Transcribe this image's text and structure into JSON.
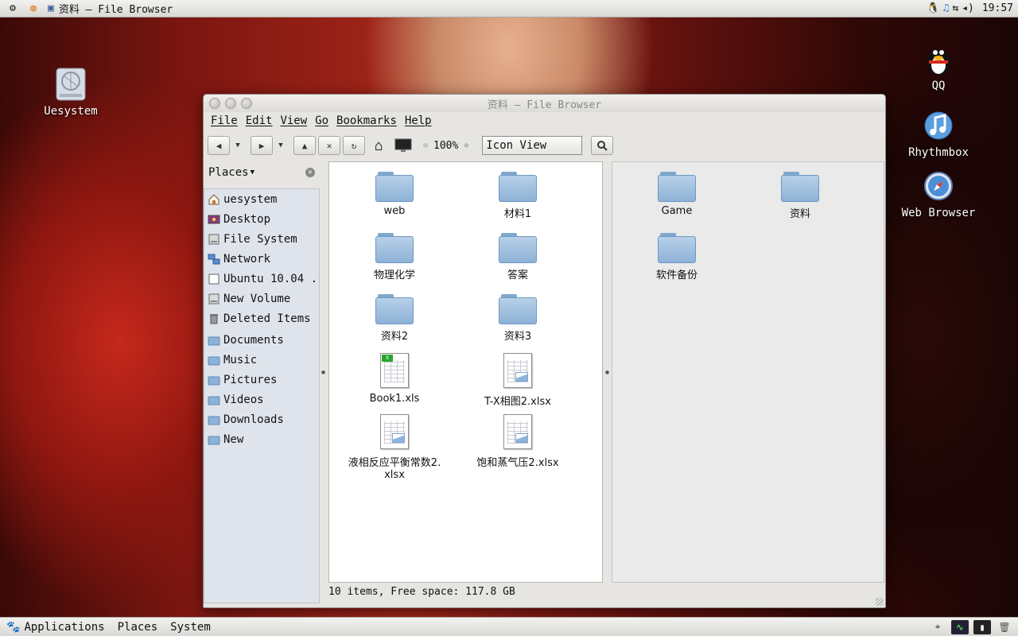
{
  "top_panel": {
    "window_title": "资料 — File Browser",
    "clock": "19:57"
  },
  "bottom_panel": {
    "menus": [
      "Applications",
      "Places",
      "System"
    ]
  },
  "desktop_icons": {
    "uesystem": "Uesystem",
    "qq": "QQ",
    "rhythmbox": "Rhythmbox",
    "web_browser": "Web Browser"
  },
  "window": {
    "title": "资料 — File Browser",
    "menu": [
      "File",
      "Edit",
      "View",
      "Go",
      "Bookmarks",
      "Help"
    ],
    "zoom": "100%",
    "view_mode": "Icon View",
    "sidebar": {
      "header": "Places",
      "items": [
        {
          "label": "uesystem",
          "icon": "home-icon"
        },
        {
          "label": "Desktop",
          "icon": "desktop-icon"
        },
        {
          "label": "File System",
          "icon": "drive-icon"
        },
        {
          "label": "Network",
          "icon": "network-icon"
        },
        {
          "label": "Ubuntu 10.04 ...",
          "icon": "disc-icon"
        },
        {
          "label": "New Volume",
          "icon": "drive-icon"
        },
        {
          "label": "Deleted Items",
          "icon": "trash-icon"
        }
      ],
      "bookmarks": [
        "Documents",
        "Music",
        "Pictures",
        "Videos",
        "Downloads",
        "New"
      ]
    },
    "left_pane": [
      {
        "name": "web",
        "type": "folder"
      },
      {
        "name": "材料1",
        "type": "folder"
      },
      {
        "name": "物理化学",
        "type": "folder"
      },
      {
        "name": "答案",
        "type": "folder"
      },
      {
        "name": "资料2",
        "type": "folder"
      },
      {
        "name": "资料3",
        "type": "folder"
      },
      {
        "name": "Book1.xls",
        "type": "spreadsheet"
      },
      {
        "name": "T-X相图2.xlsx",
        "type": "spreadsheet"
      },
      {
        "name": "液相反应平衡常数2.\nxlsx",
        "type": "spreadsheet"
      },
      {
        "name": "饱和蒸气压2.xlsx",
        "type": "spreadsheet"
      }
    ],
    "right_pane": [
      {
        "name": "Game",
        "type": "folder"
      },
      {
        "name": "资料",
        "type": "folder"
      },
      {
        "name": "软件备份",
        "type": "folder"
      }
    ],
    "status": "10 items, Free space: 117.8 GB"
  }
}
